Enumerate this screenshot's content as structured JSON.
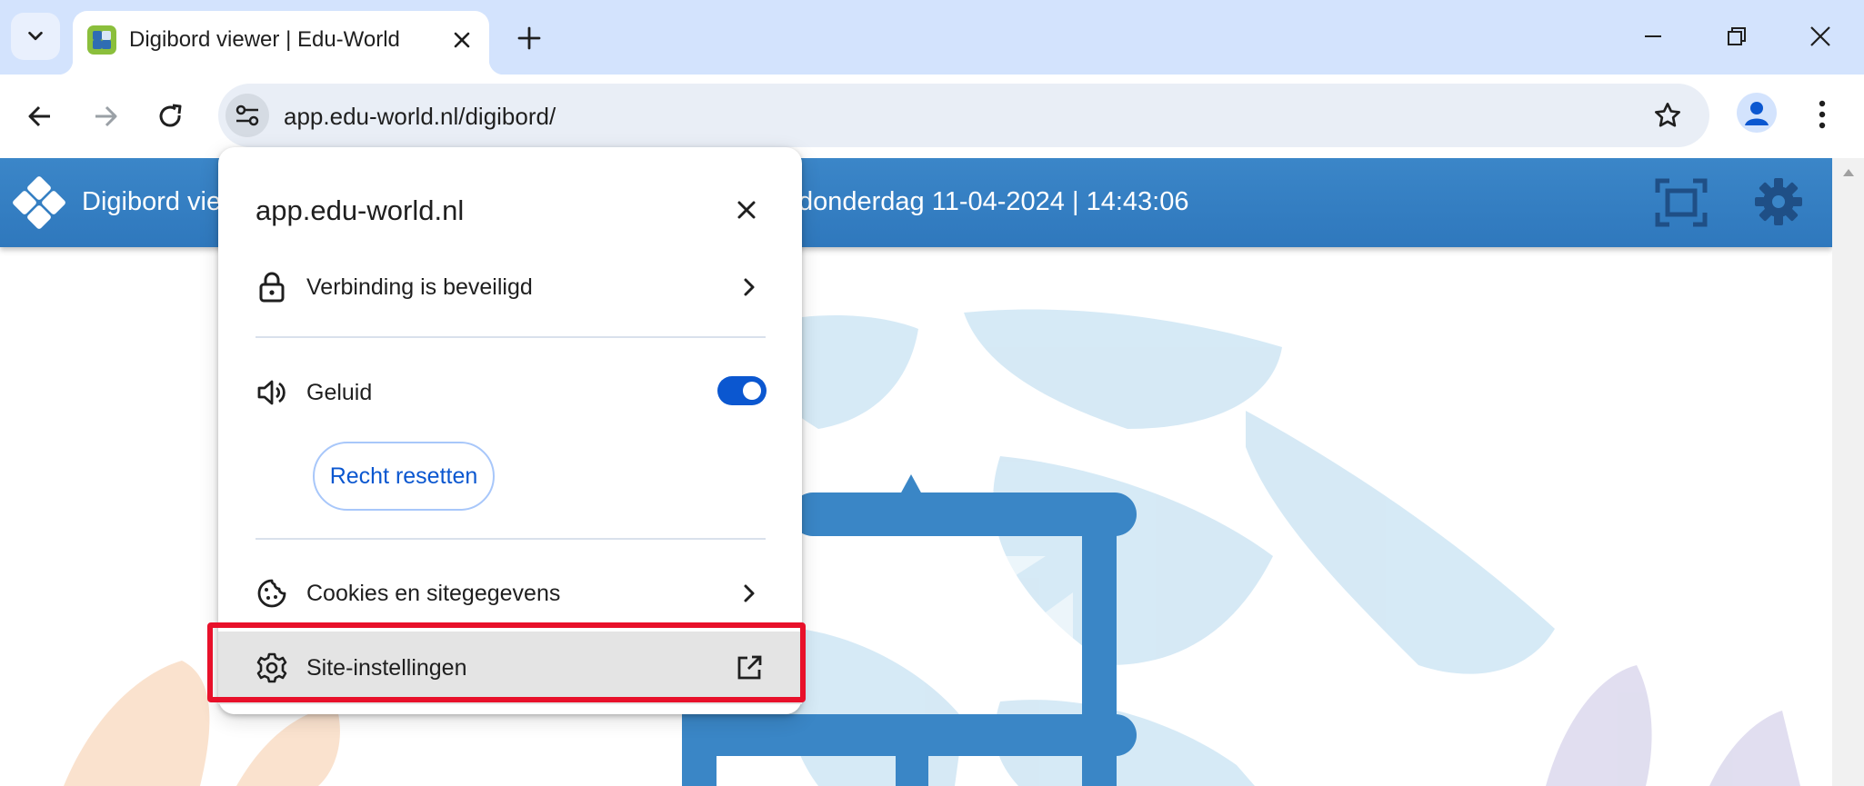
{
  "browser": {
    "tab": {
      "title": "Digibord viewer | Edu-World"
    },
    "address_bar": {
      "url": "app.edu-world.nl/digibord/"
    }
  },
  "page": {
    "header": {
      "title": "Digibord viewer",
      "datetime": "donderdag 11-04-2024 | 14:43:06"
    },
    "colors": {
      "header_blue": "#3b86c8",
      "art_light_blue": "#cfe6f4",
      "art_blue": "#3a86c6"
    }
  },
  "site_info_popup": {
    "title": "app.edu-world.nl",
    "connection_label": "Verbinding is beveiligd",
    "sound_label": "Geluid",
    "sound_enabled": true,
    "reset_button_label": "Recht resetten",
    "cookies_label": "Cookies en sitegegevens",
    "site_settings_label": "Site-instellingen"
  },
  "annotation": {
    "highlight_color": "#e8102a"
  }
}
